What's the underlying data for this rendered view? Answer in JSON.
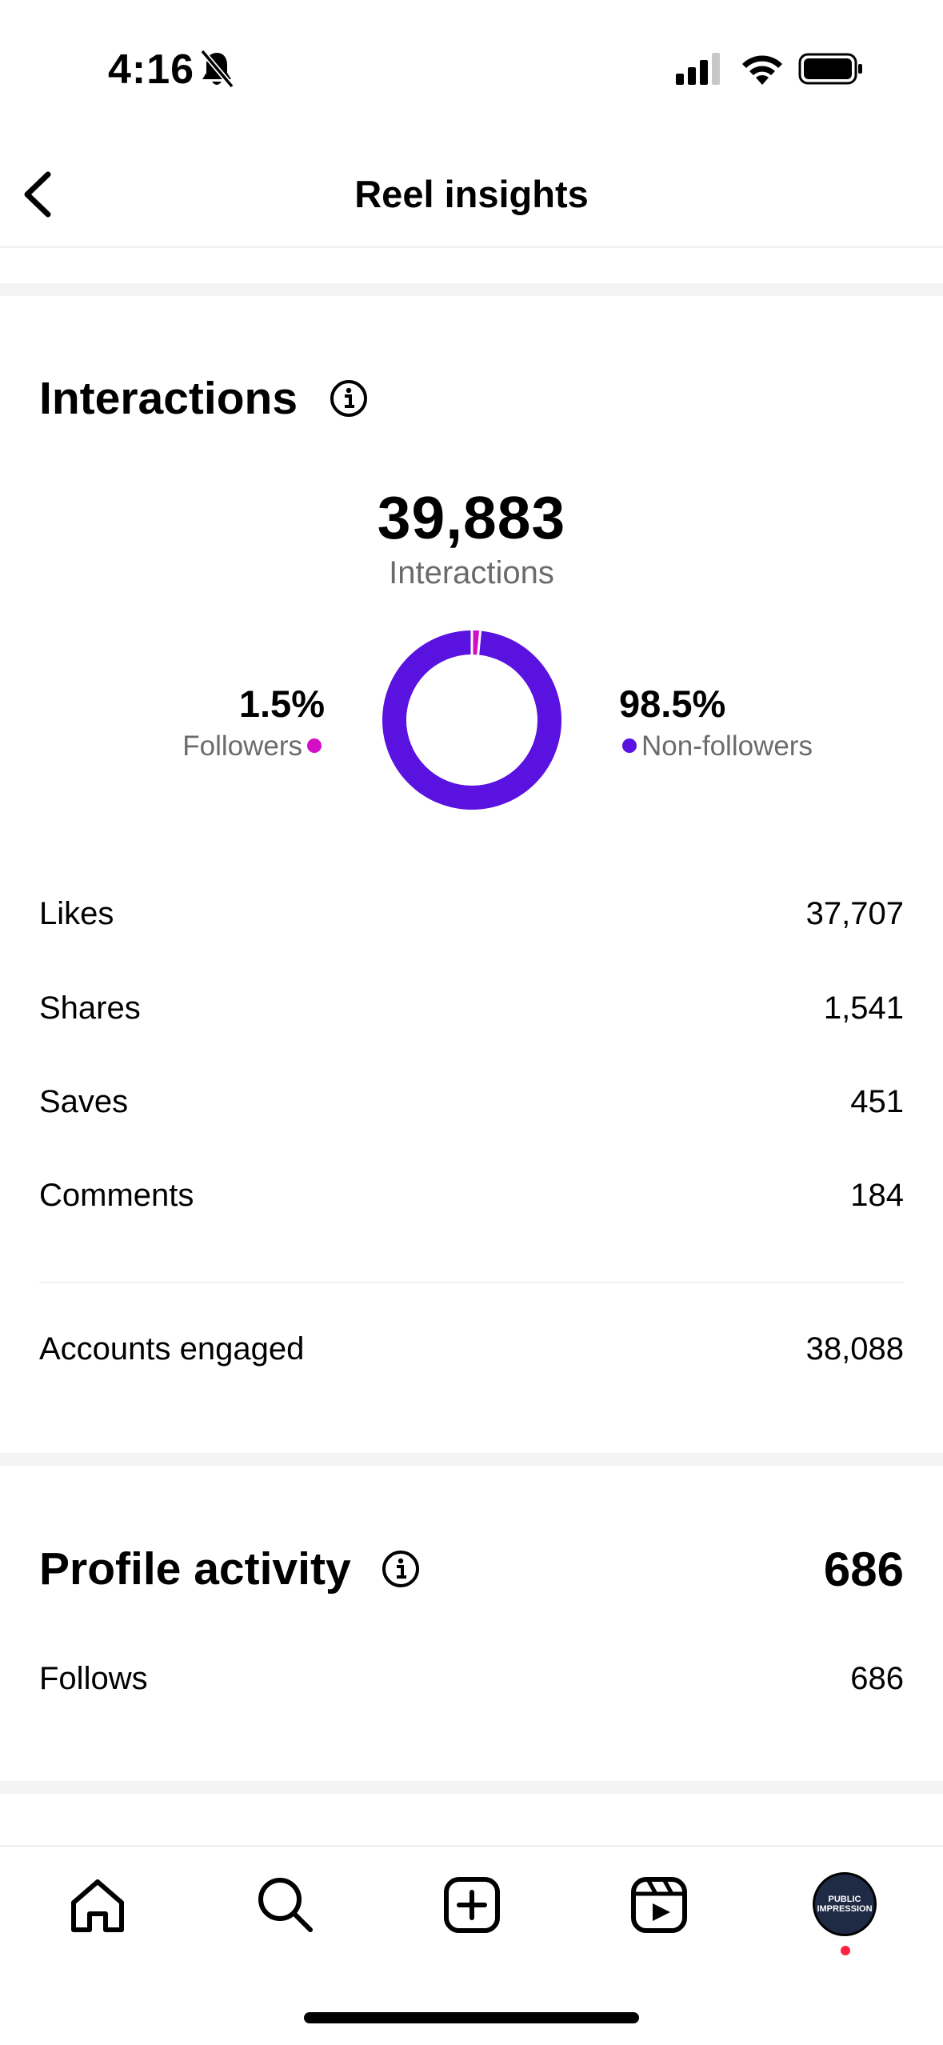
{
  "status_bar": {
    "time": "4:16"
  },
  "header": {
    "title": "Reel insights"
  },
  "interactions": {
    "title": "Interactions",
    "total": "39,883",
    "total_label": "Interactions",
    "followers_pct": "1.5%",
    "followers_label": "Followers",
    "nonfollowers_pct": "98.5%",
    "nonfollowers_label": "Non-followers",
    "followers_fraction": 0.015,
    "rows": [
      {
        "label": "Likes",
        "value": "37,707"
      },
      {
        "label": "Shares",
        "value": "1,541"
      },
      {
        "label": "Saves",
        "value": "451"
      },
      {
        "label": "Comments",
        "value": "184"
      }
    ],
    "accounts_engaged_label": "Accounts engaged",
    "accounts_engaged_value": "38,088"
  },
  "profile_activity": {
    "title": "Profile activity",
    "total": "686",
    "follows_label": "Follows",
    "follows_value": "686"
  },
  "tabbar": {
    "items": [
      "home-icon",
      "search-icon",
      "create-icon",
      "reels-icon",
      "profile-avatar"
    ],
    "avatar_text_1": "PUBLIC",
    "avatar_text_2": "IMPRESSION"
  },
  "colors": {
    "followers": "#d30ec7",
    "nonfollowers": "#5a12e0"
  }
}
